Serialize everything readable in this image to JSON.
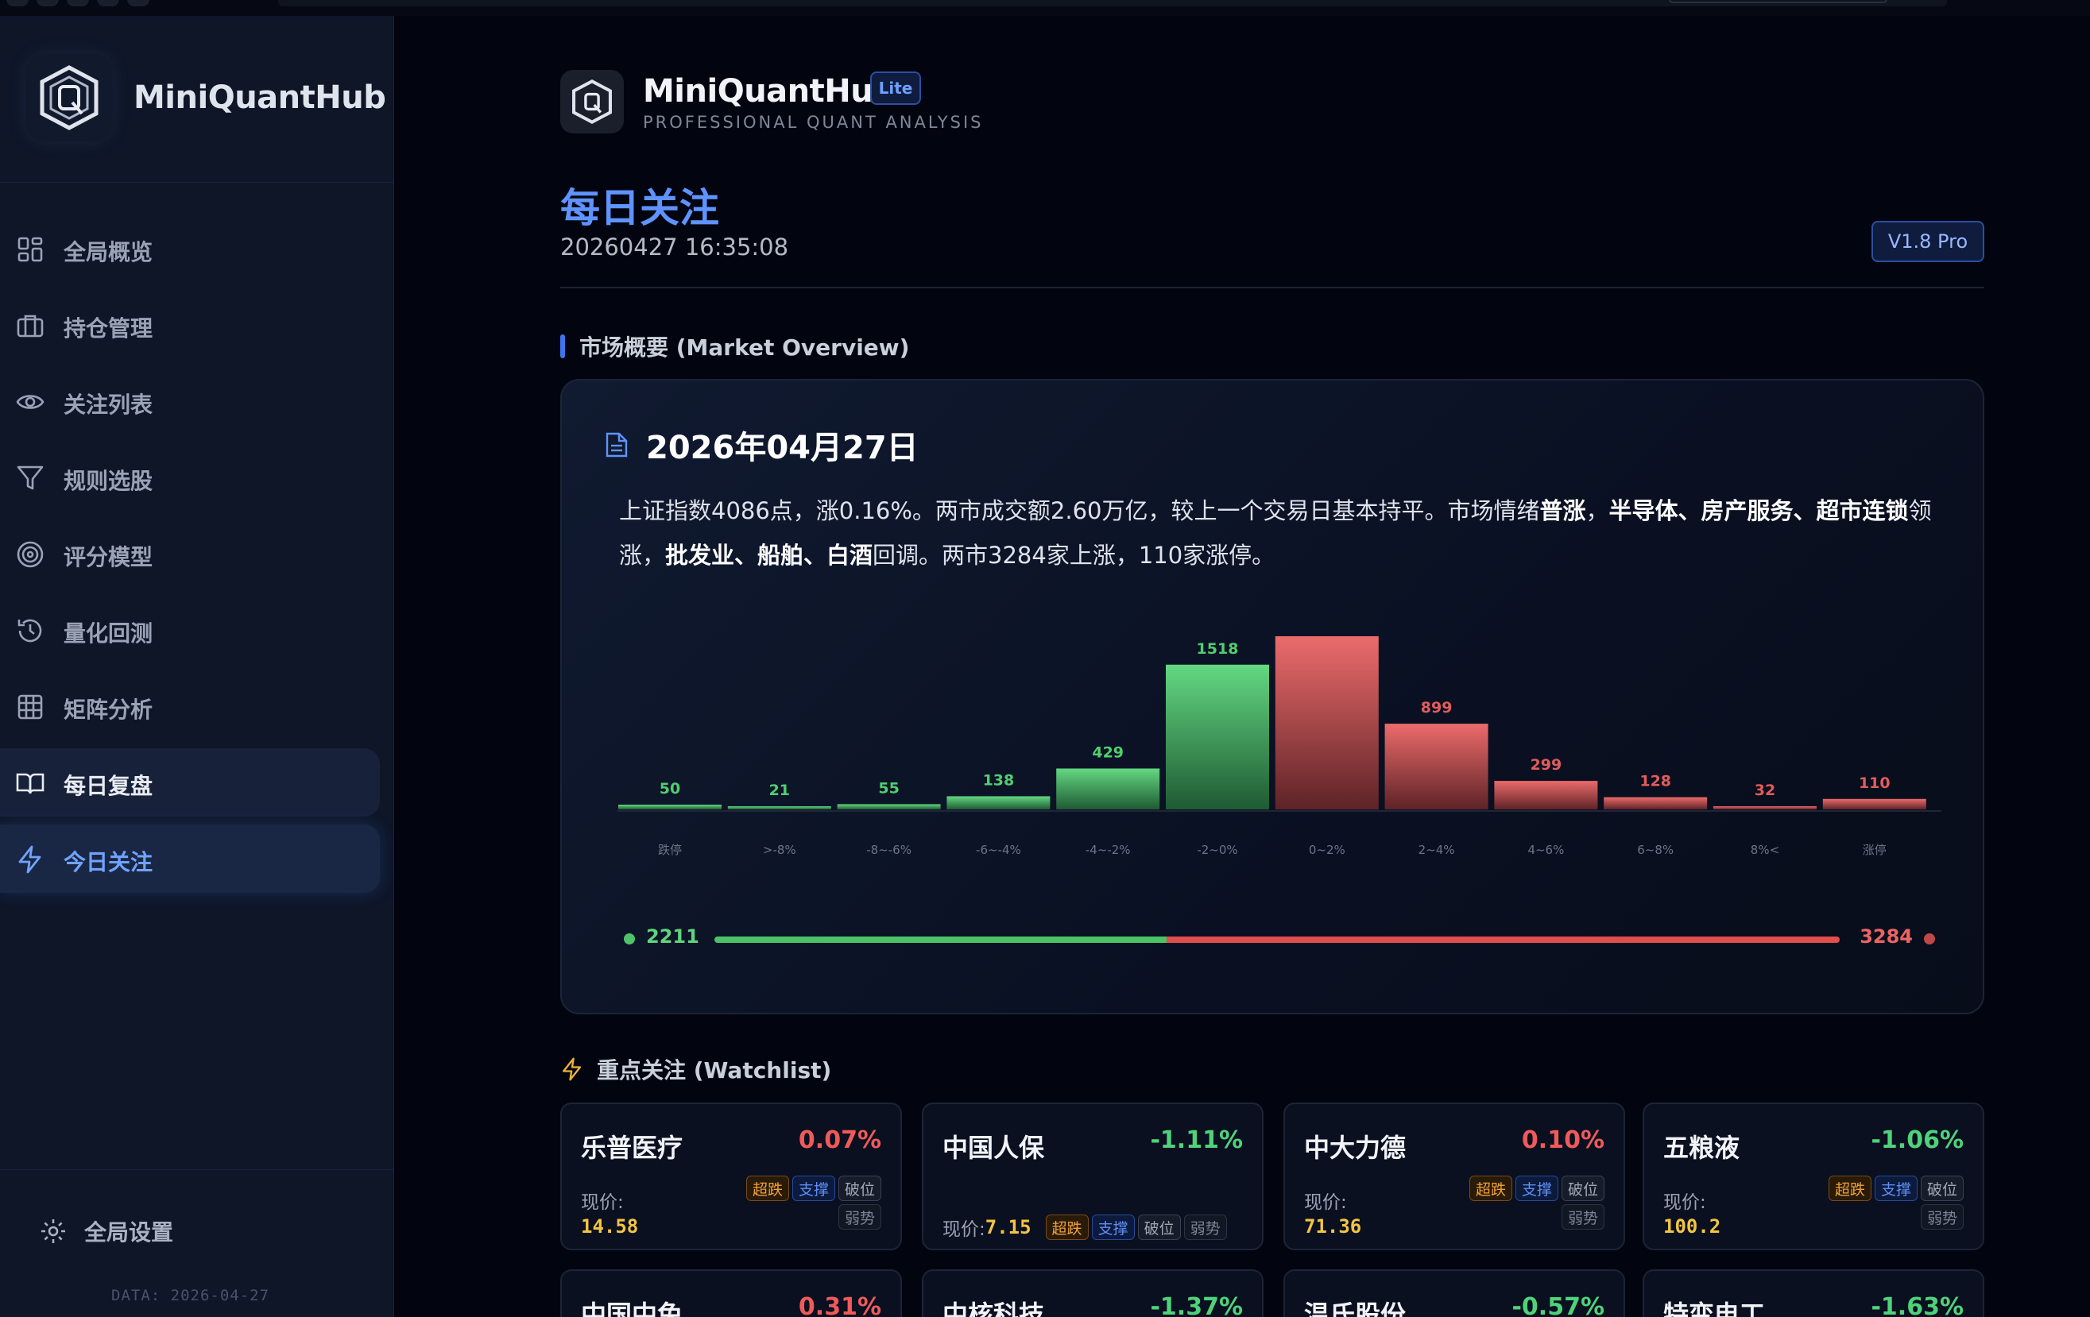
{
  "sidebar": {
    "brand": "MiniQuantHub",
    "nav": [
      {
        "label": "全局概览",
        "icon": "dashboard-icon"
      },
      {
        "label": "持仓管理",
        "icon": "briefcase-icon"
      },
      {
        "label": "关注列表",
        "icon": "eye-icon"
      },
      {
        "label": "规则选股",
        "icon": "filter-icon"
      },
      {
        "label": "评分模型",
        "icon": "target-icon"
      },
      {
        "label": "量化回测",
        "icon": "history-icon"
      },
      {
        "label": "矩阵分析",
        "icon": "grid-icon"
      },
      {
        "label": "每日复盘",
        "icon": "book-icon"
      },
      {
        "label": "今日关注",
        "icon": "lightning-icon"
      }
    ],
    "hovered_item": "每日复盘",
    "active_item": "今日关注",
    "settings_label": "全局设置",
    "data_date": "DATA: 2026-04-27"
  },
  "header": {
    "app_name": "MiniQuantHub",
    "badge": "Lite",
    "subtitle": "PROFESSIONAL QUANT ANALYSIS",
    "page_title": "每日关注",
    "timestamp": "20260427 16:35:08",
    "version": "V1.8 Pro"
  },
  "overview": {
    "section_title": "市场概要 (Market Overview)",
    "date": "2026年04月27日",
    "summary": [
      {
        "t": "上证指数4086点，涨0.16%。两市成交额2.60万亿，较上一个交易日基本持平。市场情绪",
        "b": false
      },
      {
        "t": "普涨",
        "b": true
      },
      {
        "t": "，",
        "b": false
      },
      {
        "t": "半导体、房产服务、超市连锁",
        "b": true
      },
      {
        "t": "领涨，",
        "b": false
      },
      {
        "t": "批发业、船舶、白酒",
        "b": true
      },
      {
        "t": "回调。两市3284家上涨，110家涨停。",
        "b": false
      }
    ],
    "down_count": "2211",
    "up_count": "3284",
    "down_ratio": 0.402
  },
  "chart_data": {
    "type": "bar",
    "categories": [
      "跌停",
      ">-8%",
      "-8~-6%",
      "-6~-4%",
      "-4~-2%",
      "-2~0%",
      "0~2%",
      "2~4%",
      "4~6%",
      "6~8%",
      "8%<",
      "涨停"
    ],
    "values": [
      50,
      21,
      55,
      138,
      429,
      1518,
      1816,
      899,
      299,
      128,
      32,
      110
    ],
    "direction": [
      "down",
      "down",
      "down",
      "down",
      "down",
      "down",
      "up",
      "up",
      "up",
      "up",
      "up",
      "up"
    ],
    "colors": {
      "down": "#4fcf6e",
      "up": "#e25c5c"
    },
    "ylim": [
      0,
      1816
    ],
    "grid": false,
    "legend": "none"
  },
  "watchlist": {
    "section_title": "重点关注 (Watchlist)",
    "price_label": "现价:",
    "items": [
      {
        "name": "乐普医疗",
        "change": "0.07%",
        "dir": "up",
        "price": "14.58",
        "tags": [
          "超跌",
          "支撑",
          "破位",
          "弱势"
        ]
      },
      {
        "name": "中国人保",
        "change": "-1.11%",
        "dir": "down",
        "price": "7.15",
        "tags": [
          "超跌",
          "支撑",
          "破位",
          "弱势"
        ]
      },
      {
        "name": "中大力德",
        "change": "0.10%",
        "dir": "up",
        "price": "71.36",
        "tags": [
          "超跌",
          "支撑",
          "破位",
          "弱势"
        ]
      },
      {
        "name": "五粮液",
        "change": "-1.06%",
        "dir": "down",
        "price": "100.2",
        "tags": [
          "超跌",
          "支撑",
          "破位",
          "弱势"
        ]
      },
      {
        "name": "中国中免",
        "change": "0.31%",
        "dir": "up"
      },
      {
        "name": "中核科技",
        "change": "-1.37%",
        "dir": "down"
      },
      {
        "name": "温氏股份",
        "change": "-0.57%",
        "dir": "down"
      },
      {
        "name": "特变电工",
        "change": "-1.63%",
        "dir": "down"
      }
    ]
  }
}
